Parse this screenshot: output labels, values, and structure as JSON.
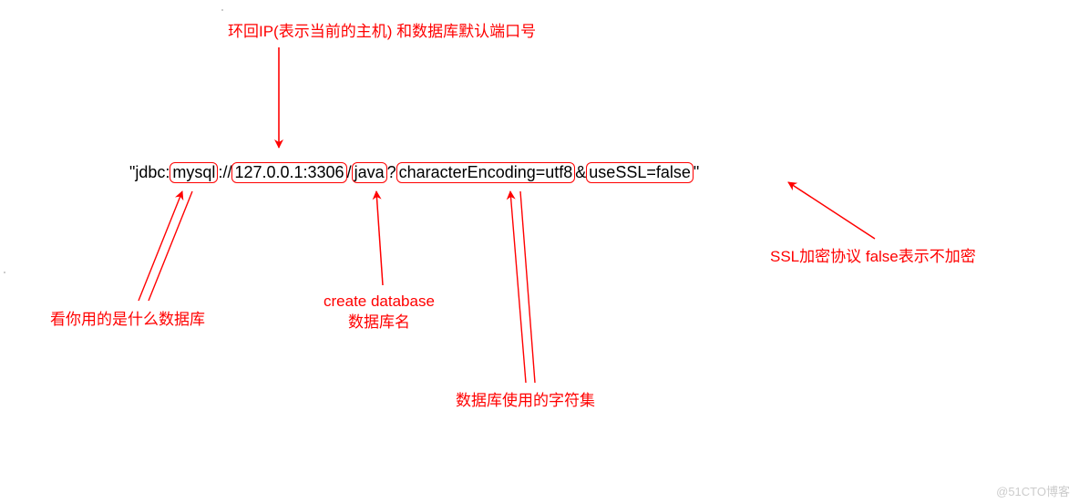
{
  "annotations": {
    "loopback": "环回IP(表示当前的主机) 和数据库默认端口号",
    "dbtype": "看你用的是什么数据库",
    "dbname_line1": "create database",
    "dbname_line2": "数据库名",
    "charset": "数据库使用的字符集",
    "ssl": "SSL加密协议  false表示不加密"
  },
  "connection_string": {
    "quote_open": "\"",
    "prefix": "jdbc:",
    "protocol": "mysql",
    "sep1": "://",
    "host_port": "127.0.0.1:3306",
    "slash": "/",
    "dbname": "java",
    "q": "?",
    "charset_param": "characterEncoding=utf8",
    "amp": "&",
    "ssl_param": "useSSL=false",
    "quote_close": "\""
  },
  "watermark": "@51CTO博客"
}
